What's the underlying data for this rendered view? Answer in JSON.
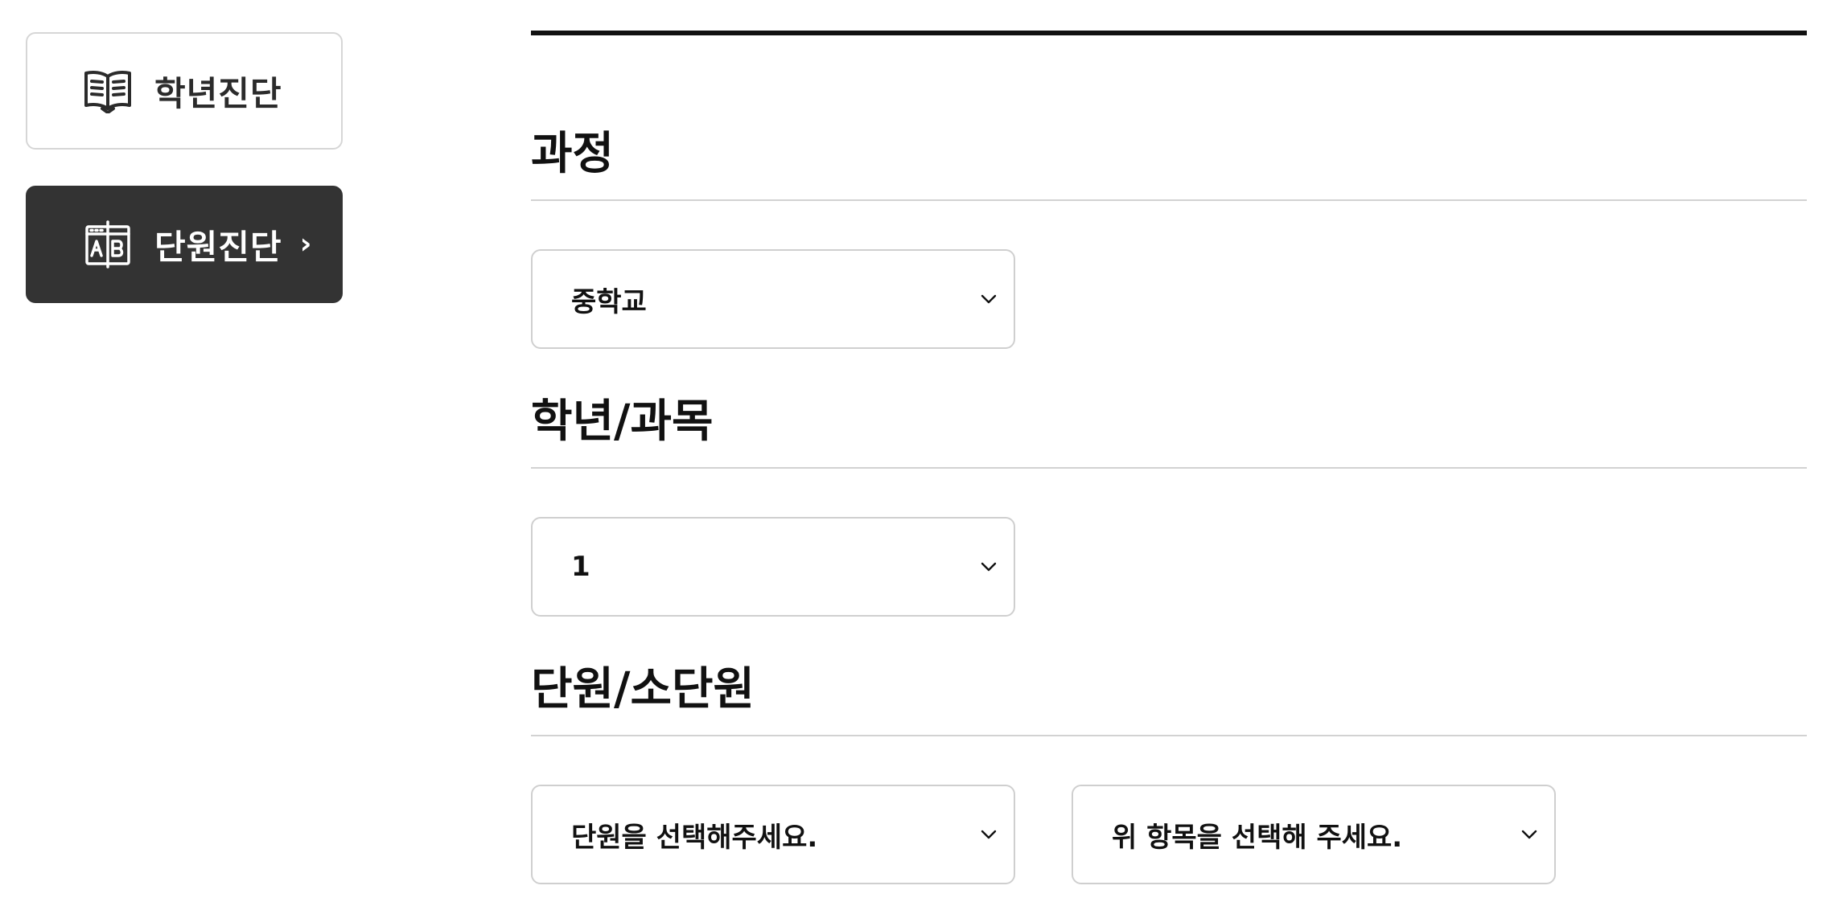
{
  "sidebar": {
    "items": [
      {
        "label": "학년진단",
        "icon": "open-book-icon",
        "active": false
      },
      {
        "label": "단원진단",
        "icon": "ab-workbook-icon",
        "active": true,
        "chevron": "›"
      }
    ]
  },
  "sections": {
    "course": {
      "title": "과정",
      "select_value": "중학교"
    },
    "grade_subject": {
      "title": "학년/과목",
      "select_value": "1"
    },
    "unit": {
      "title": "단원/소단원",
      "unit_select_value": "단원을 선택해주세요.",
      "subunit_select_value": "위 항목을 선택해 주세요."
    }
  },
  "colors": {
    "active_button_bg": "#333333",
    "inactive_button_border": "#d6d6d6",
    "select_border": "#cfcfcf",
    "rule_dark": "#111111",
    "rule_light": "#d2d2d2"
  }
}
